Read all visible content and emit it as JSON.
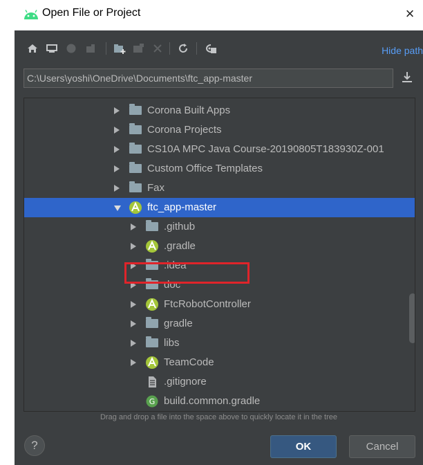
{
  "window": {
    "title": "Open File or Project",
    "close_glyph": "×"
  },
  "toolbar": {
    "icons": [
      "home-icon",
      "desktop-icon",
      "project-icon",
      "module-icon",
      "new-folder-icon",
      "delete-icon",
      "refresh-icon",
      "show-hidden-icon"
    ],
    "hide_path_label": "Hide path"
  },
  "path": {
    "value": "C:\\Users\\yoshi\\OneDrive\\Documents\\ftc_app-master"
  },
  "tree": {
    "items": [
      {
        "label": "Corona Built Apps",
        "icon": "folder-icon",
        "expandable": true,
        "expanded": false
      },
      {
        "label": "Corona Projects",
        "icon": "folder-icon",
        "expandable": true,
        "expanded": false
      },
      {
        "label": "CS10A MPC Java Course-20190805T183930Z-001",
        "icon": "folder-icon",
        "expandable": true,
        "expanded": false
      },
      {
        "label": "Custom Office Templates",
        "icon": "folder-icon",
        "expandable": true,
        "expanded": false
      },
      {
        "label": "Fax",
        "icon": "folder-icon",
        "expandable": true,
        "expanded": false
      },
      {
        "label": "ftc_app-master",
        "icon": "android-module-icon",
        "expandable": true,
        "expanded": true,
        "selected": true
      },
      {
        "label": ".github",
        "icon": "folder-icon",
        "expandable": true,
        "expanded": false
      },
      {
        "label": ".gradle",
        "icon": "android-module-icon",
        "expandable": true,
        "expanded": false
      },
      {
        "label": ".idea",
        "icon": "folder-icon",
        "expandable": true,
        "expanded": false
      },
      {
        "label": "doc",
        "icon": "folder-icon",
        "expandable": true,
        "expanded": false
      },
      {
        "label": "FtcRobotController",
        "icon": "android-module-icon",
        "expandable": true,
        "expanded": false
      },
      {
        "label": "gradle",
        "icon": "folder-icon",
        "expandable": true,
        "expanded": false
      },
      {
        "label": "libs",
        "icon": "folder-icon",
        "expandable": true,
        "expanded": false
      },
      {
        "label": "TeamCode",
        "icon": "android-module-icon",
        "expandable": true,
        "expanded": false
      },
      {
        "label": ".gitignore",
        "icon": "text-file-icon",
        "expandable": false
      },
      {
        "label": "build.common.gradle",
        "icon": "gradle-file-icon",
        "expandable": false
      }
    ]
  },
  "hint": "Drag and drop a file into the space above to quickly locate it in the tree",
  "buttons": {
    "help": "?",
    "ok": "OK",
    "cancel": "Cancel"
  },
  "colors": {
    "dialog_bg": "#3c3f41",
    "selection": "#2f65ca",
    "highlight_box": "#e0242a",
    "android_green": "#a4c639",
    "link_blue": "#589df6"
  }
}
